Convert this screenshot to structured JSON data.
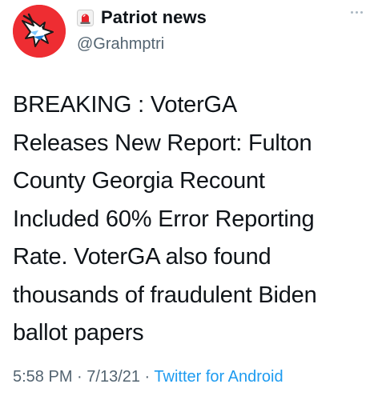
{
  "author": {
    "emoji_icon": "rotating-light-icon",
    "display_name": "Patriot news",
    "handle": "@Grahmptri"
  },
  "menu": {
    "icon": "more-dots-icon"
  },
  "tweet": {
    "text": "BREAKING : VoterGA\nReleases New Report: Fulton\nCounty Georgia Recount\nIncluded 60% Error Reporting\nRate. VoterGA also found\nthousands of fraudulent Biden\nballot papers"
  },
  "meta": {
    "time": "5:58 PM",
    "separator": " · ",
    "date": "7/13/21",
    "separator2": " · ",
    "source": "Twitter for Android"
  },
  "colors": {
    "avatar_bg": "#ee2d32",
    "link": "#1d9bf0",
    "muted": "#536471"
  }
}
